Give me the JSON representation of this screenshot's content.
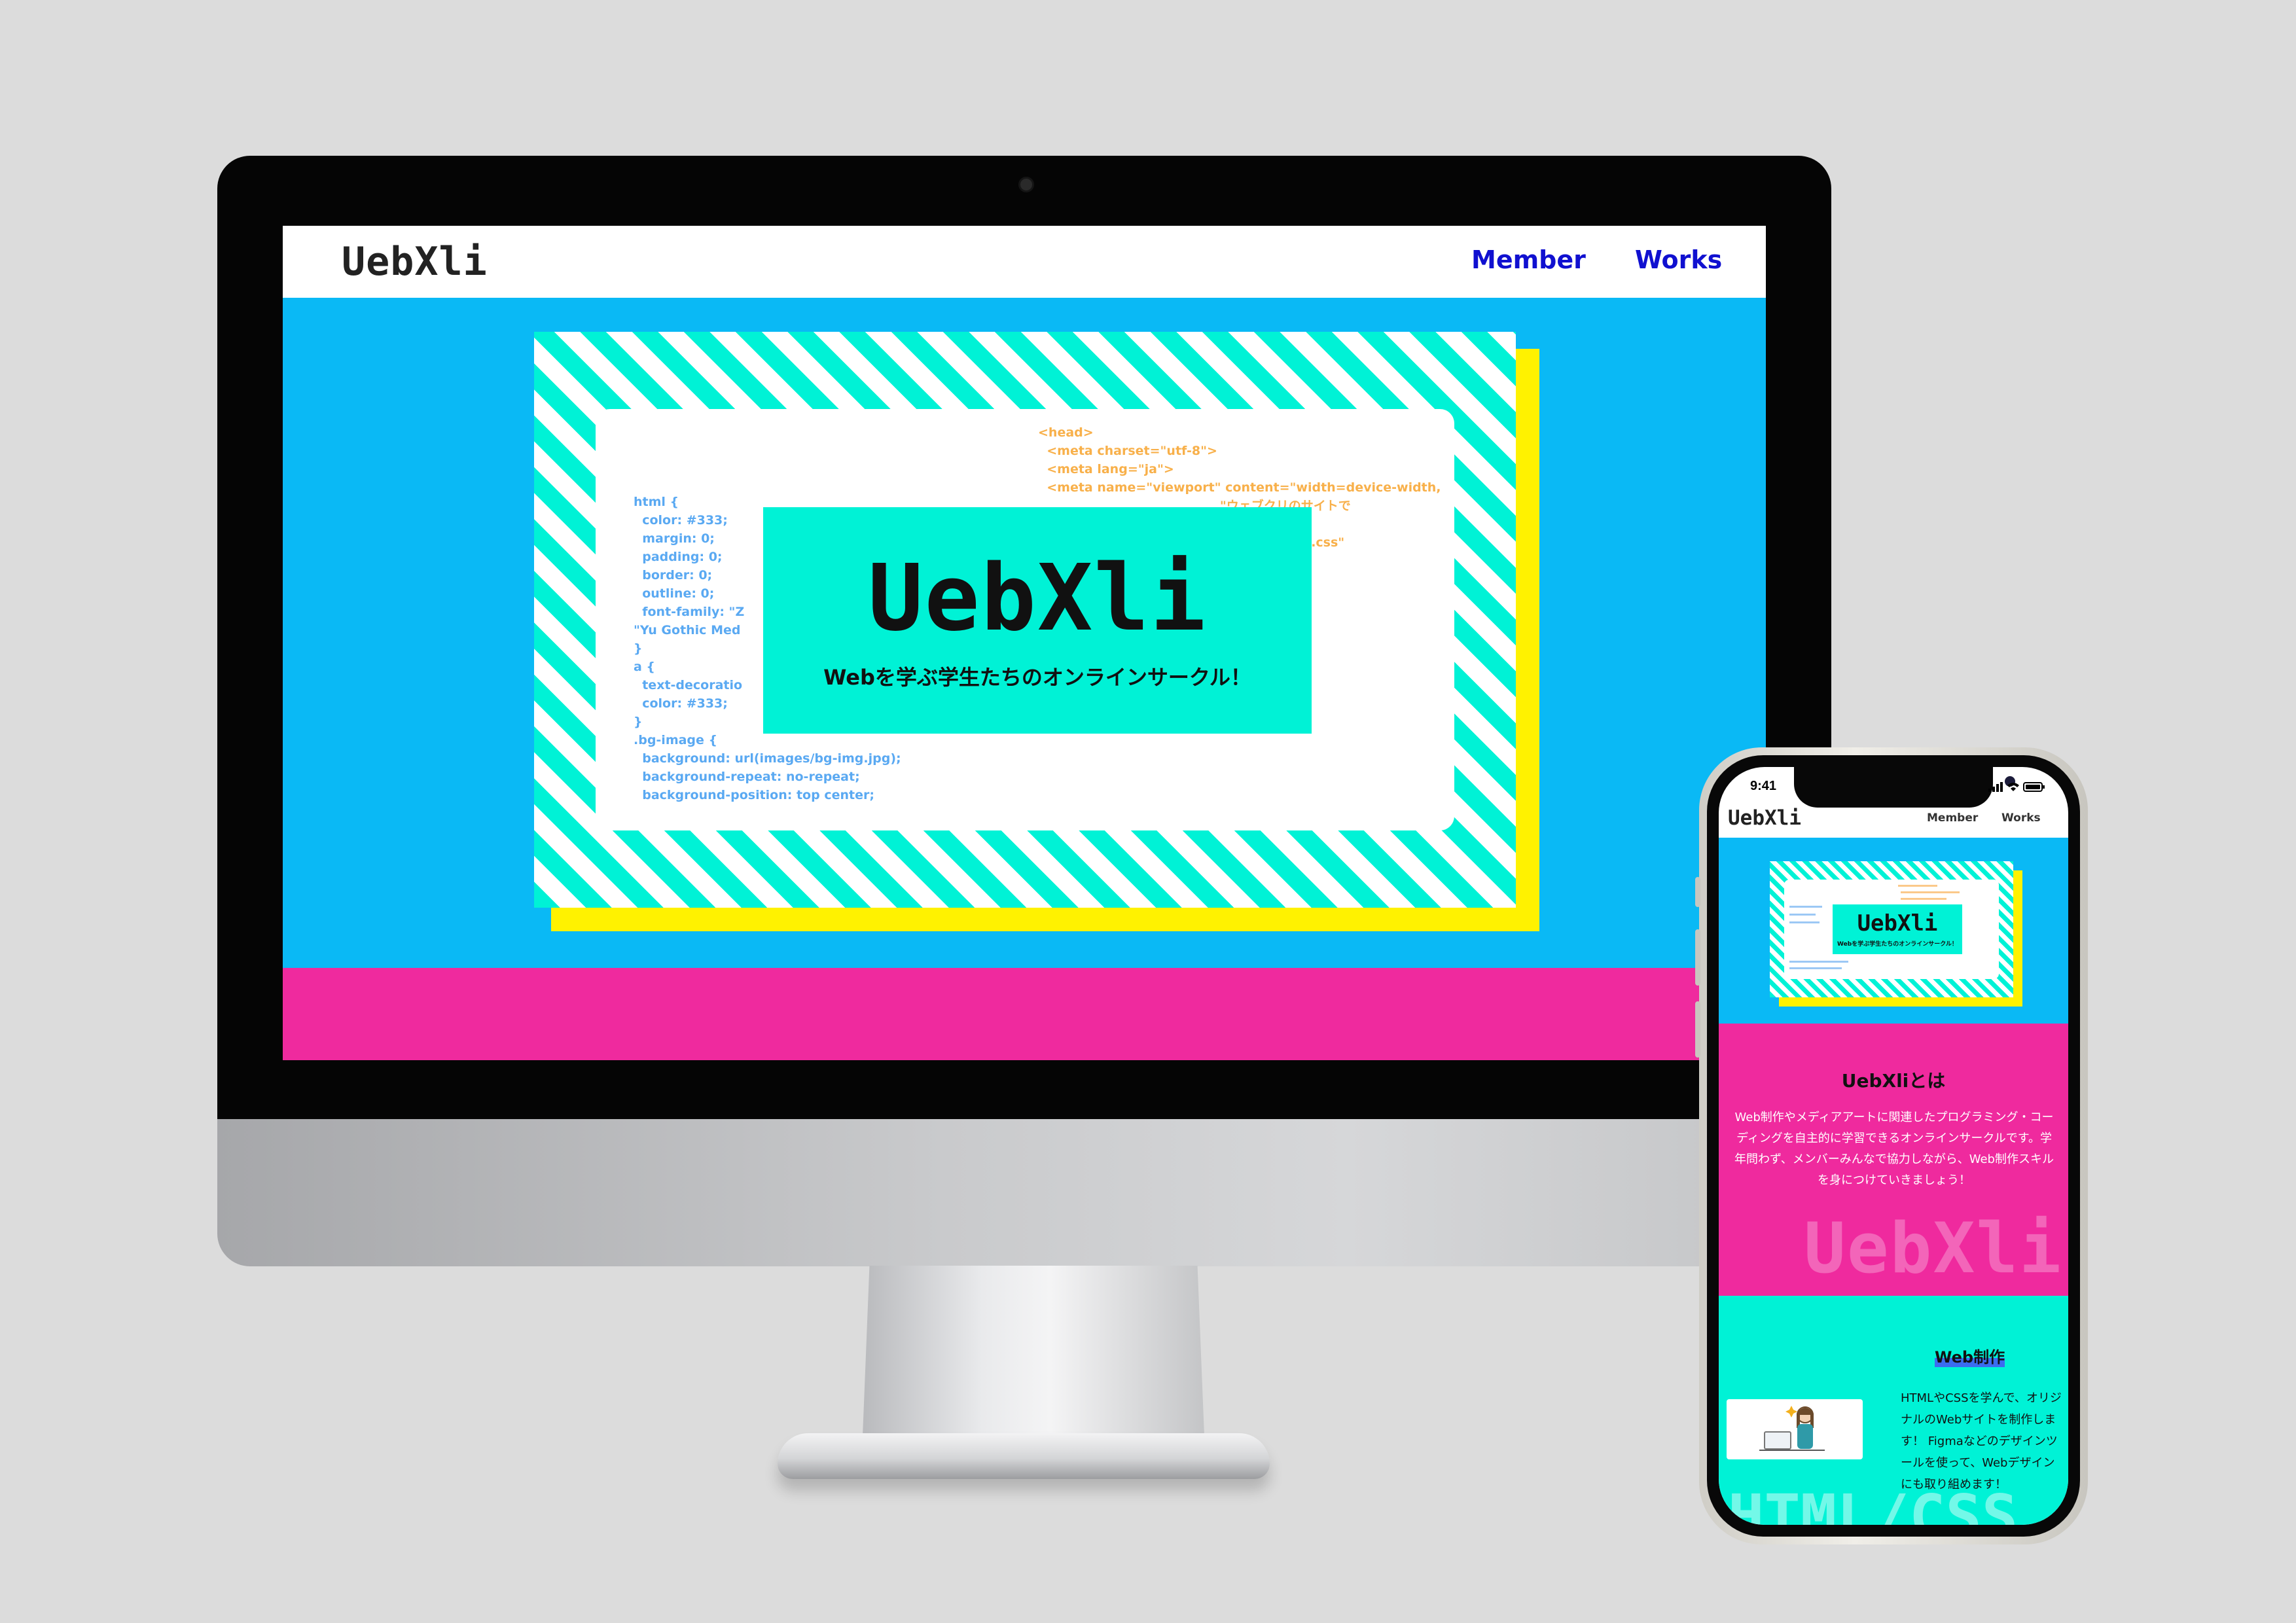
{
  "desktop": {
    "logo": "UebXli",
    "nav": [
      "Member",
      "Works"
    ],
    "hero": {
      "title": "UebXli",
      "subtitle": "Webを学ぶ学生たちのオンラインサークル！",
      "code_left": "html {\n  color: #333;\n  margin: 0;\n  padding: 0;\n  border: 0;\n  outline: 0;\n  font-family: \"Z\n\"Yu Gothic Med\n}\na {\n  text-decoratio\n  color: #333;\n}\n.bg-image {\n  background: url(images/bg-img.jpg);\n  background-repeat: no-repeat;\n  background-position: top center;",
      "code_right": "<head>\n  <meta charset=\"utf-8\">\n  <meta lang=\"ja\">\n  <meta name=\"viewport\" content=\"width=device-width,\n                                          \"ウェブクリのサイトで\n\n                                          dist/ress.min.css\"\n\n                                          .com/css2?\n                                          ylesheet\">\n                                          ss\">"
    },
    "colors": {
      "header_bg": "#ffffff",
      "page_bg": "#0ab9f5",
      "stripe": "#00f2d6",
      "shadow": "#fff200",
      "band": "#ef2a9e",
      "nav_link": "#1010d0"
    }
  },
  "phone": {
    "status_time": "9:41",
    "status_icons": "signal-icon wifi-icon battery-icon",
    "logo": "UebXli",
    "nav": [
      "Member",
      "Works"
    ],
    "hero": {
      "title": "UebXli",
      "subtitle": "Webを学ぶ学生たちのオンラインサークル！"
    },
    "about": {
      "title": "UebXliとは",
      "text": "Web制作やメディアアートに関連したプログラミング・コーディングを自主的に学習できるオンラインサークルです。学年問わず、メンバーみんなで協力しながら、Web制作スキルを身につけていきましょう！",
      "watermark": "UebXli"
    },
    "web": {
      "title": "Web制作",
      "text": "HTMLやCSSを学んで、オリジナルのWebサイトを制作します！ Figmaなどのデザインツールを使って、Webデザインにも取り組めます！",
      "watermark": "HTML/CSS",
      "image_icon": "developer-illustration-icon"
    }
  }
}
